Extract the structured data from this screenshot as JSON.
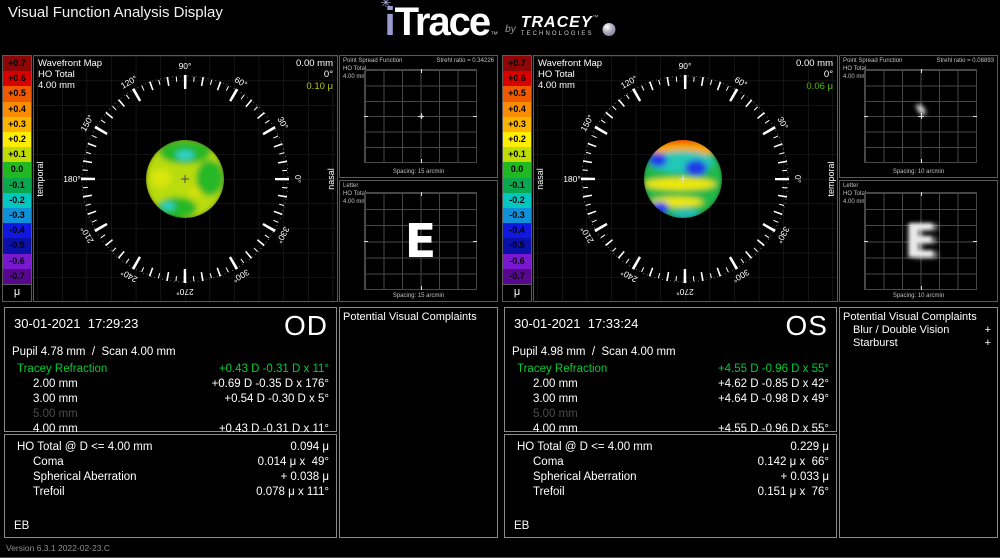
{
  "app": {
    "title": "Visual Function Analysis Display",
    "version": "Version 6.3.1 2022-02-23.C"
  },
  "logo": {
    "star": "✳",
    "i": "i",
    "trace": "Trace",
    "tm": "™",
    "by": "by",
    "tracey": "TRACEY",
    "tracey_tm": "™",
    "technologies": "TECHNOLOGIES"
  },
  "scale": {
    "labels": [
      "+0.7",
      "+0.6",
      "+0.5",
      "+0.4",
      "+0.3",
      "+0.2",
      "+0.1",
      "0.0",
      "-0.1",
      "-0.2",
      "-0.3",
      "-0.4",
      "-0.5",
      "-0.6",
      "-0.7"
    ],
    "colors": [
      "#8f0606",
      "#d90000",
      "#ef5a00",
      "#f98c00",
      "#fbb500",
      "#ffee00",
      "#bfdc00",
      "#22b822",
      "#0aa84e",
      "#00c8c0",
      "#1090d8",
      "#1018e0",
      "#0b10a8",
      "#7a18d0",
      "#58088e"
    ],
    "unit": "μ"
  },
  "map": {
    "title": [
      "Wavefront Map",
      "HO Total",
      "4.00 mm"
    ],
    "angles": [
      "90°",
      "120°",
      "150°",
      "180°",
      "210°",
      "240°",
      "270°",
      "300°",
      "330°",
      "0°",
      "30°",
      "60°"
    ]
  },
  "psf_title": [
    "Point Spread Function",
    "HO Total",
    "4.00 mm"
  ],
  "letter_title": [
    "Letter",
    "HO Total",
    "4.00 mm"
  ],
  "letter_glyph": "E",
  "od": {
    "eye": "OD",
    "datetime": "30-01-2021  17:29:23",
    "pupil": "Pupil 4.78 mm  /  Scan 4.00 mm",
    "cursor": {
      "mm": "0.00 mm",
      "deg": "0°",
      "mu": "0.10 μ",
      "mu_color": "#b8c400"
    },
    "side_left": "temporal",
    "side_right": "nasal",
    "strehl": "Strehl ratio = 0.34226",
    "spacing": "Spacing:  15 arcmin",
    "refr_label": "Tracey Refraction",
    "refr_value": "+0.43 D -0.31 D x 11°",
    "refr_rows": [
      {
        "label": "2.00 mm",
        "value": "+0.69 D -0.35 D x 176°"
      },
      {
        "label": "3.00 mm",
        "value": "+0.54 D -0.30 D x 5°"
      },
      {
        "label": "5.00 mm",
        "value": ""
      },
      {
        "label": "4.00 mm",
        "value": "+0.43 D -0.31 D x 11°"
      }
    ],
    "ho_label": "HO Total @ D <= 4.00 mm",
    "ho_value": "0.094 μ",
    "ho_rows": [
      {
        "label": "Coma",
        "value": "0.014 μ x  49°"
      },
      {
        "label": "Spherical Aberration",
        "value": "+ 0.038 μ"
      },
      {
        "label": "Trefoil",
        "value": "0.078 μ x 111°"
      }
    ],
    "operator": "EB",
    "complaints_title": "Potential Visual Complaints"
  },
  "os": {
    "eye": "OS",
    "datetime": "30-01-2021  17:33:24",
    "pupil": "Pupil 4.98 mm  /  Scan 4.00 mm",
    "cursor": {
      "mm": "0.00 mm",
      "deg": "0°",
      "mu": "0.06 μ",
      "mu_color": "#55b800"
    },
    "side_left": "nasal",
    "side_right": "temporal",
    "strehl": "Strehl ratio = 0.08893",
    "spacing": "Spacing:  10 arcmin",
    "refr_label": "Tracey Refraction",
    "refr_value": "+4.55 D -0.96 D x 55°",
    "refr_rows": [
      {
        "label": "2.00 mm",
        "value": "+4.62 D -0.85 D x 42°"
      },
      {
        "label": "3.00 mm",
        "value": "+4.64 D -0.98 D x 49°"
      },
      {
        "label": "5.00 mm",
        "value": ""
      },
      {
        "label": "4.00 mm",
        "value": "+4.55 D -0.96 D x 55°"
      }
    ],
    "ho_label": "HO Total @ D <= 4.00 mm",
    "ho_value": "0.229 μ",
    "ho_rows": [
      {
        "label": "Coma",
        "value": "0.142 μ x  66°"
      },
      {
        "label": "Spherical Aberration",
        "value": "+ 0.033 μ"
      },
      {
        "label": "Trefoil",
        "value": "0.151 μ x  76°"
      }
    ],
    "operator": "EB",
    "complaints_title": "Potential Visual Complaints",
    "complaints": [
      {
        "label": "Blur / Double Vision",
        "flag": "+"
      },
      {
        "label": "Starburst",
        "flag": "+"
      }
    ]
  }
}
